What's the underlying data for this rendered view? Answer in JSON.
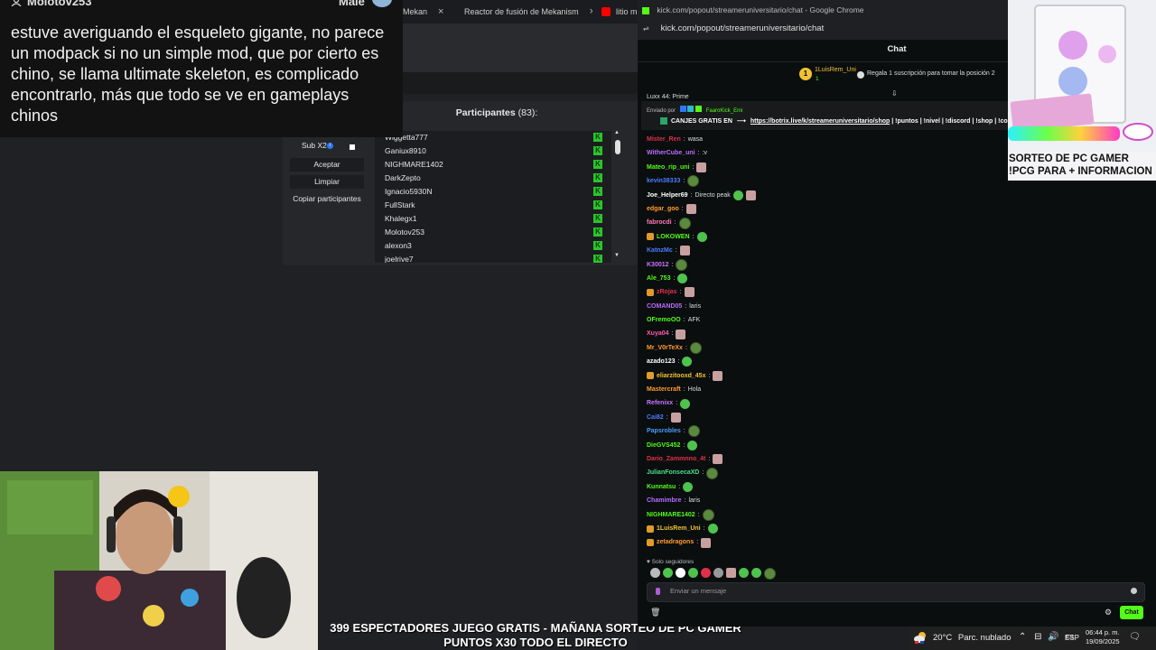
{
  "browser_tabs": [
    {
      "label": "Mekan",
      "close": "×"
    },
    {
      "label": "Reactor de fusión de Mekanism",
      "close": "×"
    },
    {
      "label": "litio m",
      "close": ""
    }
  ],
  "participants_panel": {
    "title": "Participantes",
    "count": "(83):",
    "sub_label": "Sub X2",
    "buttons": [
      "Aceptar",
      "Limpiar",
      "Copiar participantes"
    ],
    "names": [
      "Wiggetta777",
      "Ganiux8910",
      "NIGHMARE1402",
      "DarkZepto",
      "Ignacio5930N",
      "FullStark",
      "Khalegx1",
      "Molotov253",
      "alexon3",
      "joelrive7"
    ],
    "k_mark": "K"
  },
  "overlay_message": {
    "username": "Molotov253",
    "gender": "Male",
    "text": "estuve averiguando el esqueleto gigante, no parece un modpack si no un simple mod, que por cierto es chino, se llama ultimate skeleton, es complicado encontrarlo, más que todo se ve en gameplays chinos"
  },
  "ticker": {
    "line1": "399 ESPECTADORES JUEGO GRATIS - MAÑANA SORTEO DE PC GAMER",
    "line2": "PUNTOS X30 TODO EL DIRECTO"
  },
  "chat_window": {
    "window_title": "kick.com/popout/streameruniversitario/chat - Google Chrome",
    "url": "kick.com/popout/streameruniversitario/chat",
    "header": "Chat",
    "top_donor": {
      "name": "1LuisRem_Uni",
      "count": "1"
    },
    "gift_text": "Regala 1 suscripción para tomar la posición 2",
    "pinned": {
      "sent_by_label": "Enviado por",
      "sent_by_user": "FaaroKick_Emi",
      "prefix": "CANJES GRATIS EN",
      "link": "https://botrix.live/k/streameruniversitario/shop",
      "suffix": "| !puntos | !nivel | !discord | !shop | !co"
    },
    "partial_top": "Luxx 44: Prime",
    "messages": [
      {
        "user": "Mister_Ren",
        "color": "#e0304a",
        "text": "wasa",
        "emotes": 0,
        "badge": false
      },
      {
        "user": "WitherCube_uni",
        "color": "#b86dff",
        "text": ":v",
        "emotes": 0,
        "badge": false
      },
      {
        "user": "Mateo_rip_uni",
        "color": "#53fc18",
        "text": "",
        "emotes": 1,
        "badge": false
      },
      {
        "user": "kevin38333",
        "color": "#4a7dff",
        "text": "",
        "emotes": 1,
        "badge": false
      },
      {
        "user": "Joe_Helper69",
        "color": "#ffffff",
        "text": "Directo peak",
        "emotes": 2,
        "badge": false
      },
      {
        "user": "edgar_goo",
        "color": "#ff9c2a",
        "text": "",
        "emotes": 1,
        "badge": false
      },
      {
        "user": "fabrocdi",
        "color": "#ff7ab8",
        "text": "",
        "emotes": 1,
        "badge": false
      },
      {
        "user": "LOKOWEN",
        "color": "#53fc18",
        "text": "",
        "emotes": 1,
        "badge": true
      },
      {
        "user": "KatnzMc",
        "color": "#4a7dff",
        "text": "",
        "emotes": 1,
        "badge": false
      },
      {
        "user": "K30012",
        "color": "#c873ff",
        "text": "",
        "emotes": 1,
        "badge": false
      },
      {
        "user": "Ale_753",
        "color": "#53fc18",
        "text": "",
        "emotes": 1,
        "badge": false
      },
      {
        "user": "zRojas",
        "color": "#e0304a",
        "text": "",
        "emotes": 1,
        "badge": true
      },
      {
        "user": "COMAND05",
        "color": "#b86dff",
        "text": "laris",
        "emotes": 0,
        "badge": false
      },
      {
        "user": "OFremoOO",
        "color": "#53fc18",
        "text": "AFK",
        "emotes": 0,
        "badge": false
      },
      {
        "user": "Xuya04",
        "color": "#ff5ab0",
        "text": "",
        "emotes": 1,
        "badge": false
      },
      {
        "user": "Mr_V0rTeXx",
        "color": "#ff9c2a",
        "text": "",
        "emotes": 1,
        "badge": false
      },
      {
        "user": "azado123",
        "color": "#ffffff",
        "text": "",
        "emotes": 1,
        "badge": false
      },
      {
        "user": "eliarzitooxd_45x",
        "color": "#f0c232",
        "text": "",
        "emotes": 1,
        "badge": true
      },
      {
        "user": "Mastercraft",
        "color": "#ff9c2a",
        "text": "Hola",
        "emotes": 0,
        "badge": false
      },
      {
        "user": "Refenixx",
        "color": "#c873ff",
        "text": "",
        "emotes": 1,
        "badge": false
      },
      {
        "user": "Cai82",
        "color": "#4a7dff",
        "text": "",
        "emotes": 1,
        "badge": false
      },
      {
        "user": "Papsrobles",
        "color": "#4a9dff",
        "text": "",
        "emotes": 1,
        "badge": false
      },
      {
        "user": "DieGVS452",
        "color": "#53fc18",
        "text": "",
        "emotes": 1,
        "badge": false
      },
      {
        "user": "Dario_Zammnno_4t",
        "color": "#e0304a",
        "text": "",
        "emotes": 1,
        "badge": false
      },
      {
        "user": "JulianFonsecaXD",
        "color": "#4adf8a",
        "text": "",
        "emotes": 1,
        "badge": false
      },
      {
        "user": "Kunnatsu",
        "color": "#53fc18",
        "text": "",
        "emotes": 1,
        "badge": false
      },
      {
        "user": "Chamimbre",
        "color": "#b86dff",
        "text": "laris",
        "emotes": 0,
        "badge": false
      },
      {
        "user": "NIGHMARE1402",
        "color": "#53fc18",
        "text": "",
        "emotes": 1,
        "badge": false
      },
      {
        "user": "1LuisRem_Uni",
        "color": "#f0c232",
        "text": "",
        "emotes": 1,
        "badge": true
      },
      {
        "user": "zetadragons",
        "color": "#ff9c2a",
        "text": "",
        "emotes": 1,
        "badge": true
      }
    ],
    "followers_only": "Solo seguidores",
    "input_placeholder": "Enviar un mensaje",
    "send_label": "Chat"
  },
  "ad": {
    "text": "SORTEO DE PC GAMER !PCG PARA + INFORMACION"
  },
  "taskbar": {
    "temperature": "20°C",
    "weather": "Parc. nublado",
    "language": "ESP",
    "time": "06:44 p. m.",
    "date": "19/09/2025"
  },
  "colors": {
    "kick_green": "#53fc18",
    "panel_bg": "#0b0e0f"
  }
}
